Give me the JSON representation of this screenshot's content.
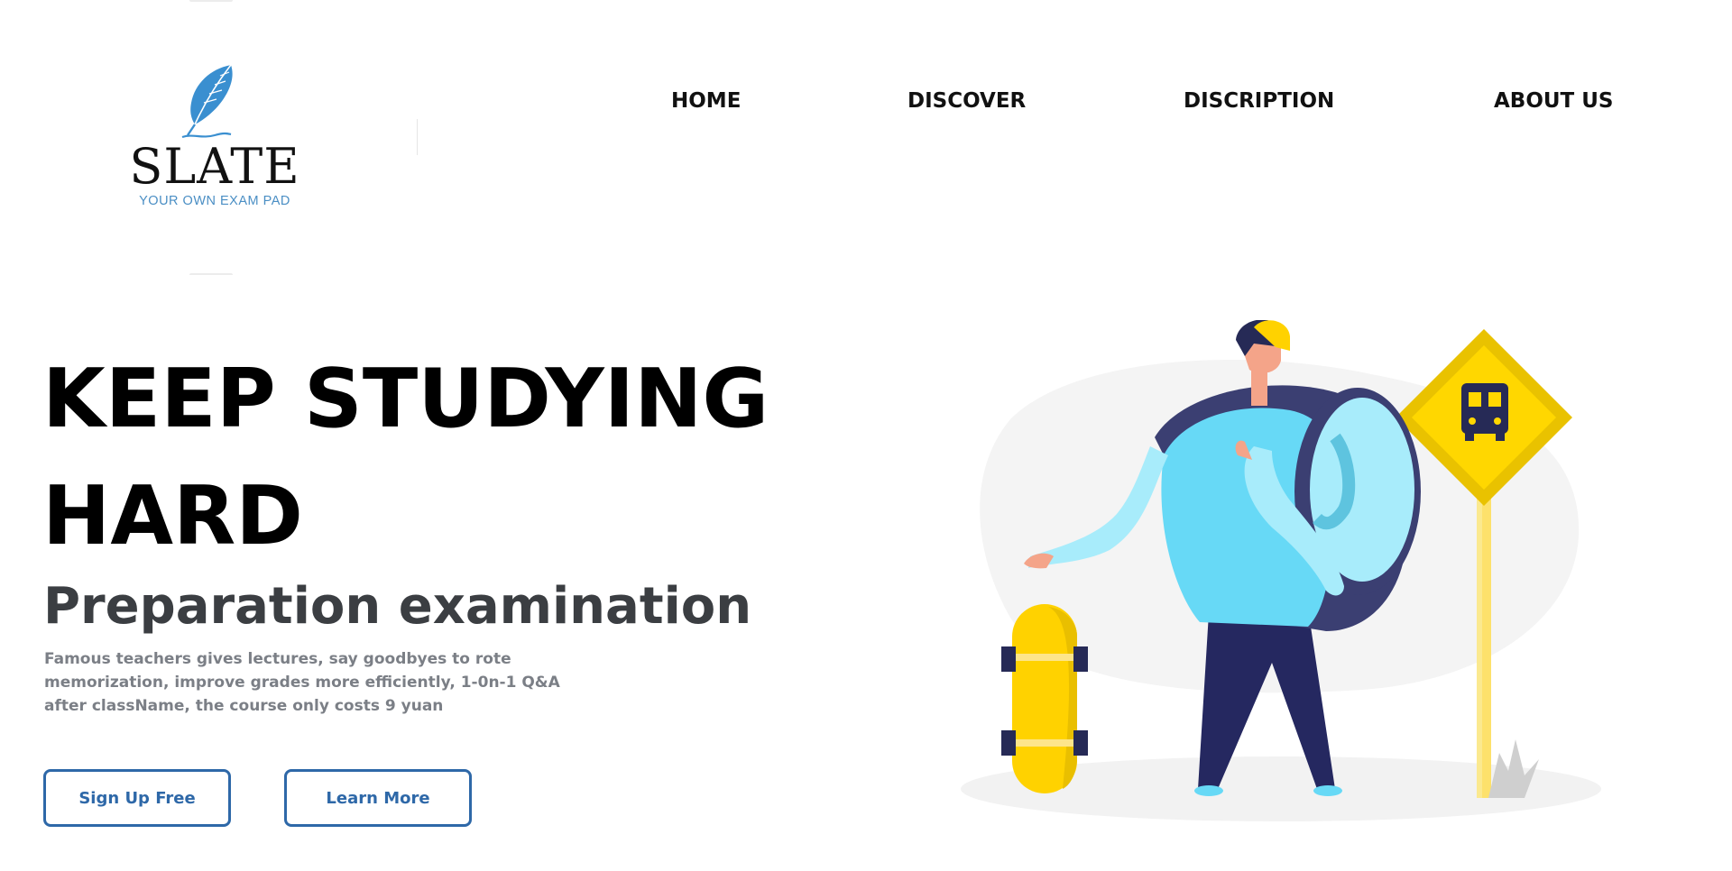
{
  "brand": {
    "name": "SLATE",
    "tagline": "YOUR OWN EXAM PAD"
  },
  "nav": {
    "items": [
      {
        "label": "HOME"
      },
      {
        "label": "DISCOVER"
      },
      {
        "label": "DISCRIPTION"
      },
      {
        "label": "ABOUT US"
      }
    ]
  },
  "hero": {
    "title_line1": "KEEP STUDYING",
    "title_line2": "HARD",
    "subtitle": "Preparation examination",
    "description": "Famous teachers gives lectures, say goodbyes to rote memorization, improve grades more efficiently, 1-0n-1 Q&A after className, the course only costs 9 yuan",
    "buttons": {
      "signup_label": "Sign Up Free",
      "learn_label": "Learn More"
    }
  },
  "colors": {
    "accent": "#2e68a8",
    "text": "#000000",
    "subtitle": "#3b3e42",
    "description": "#7b7f86",
    "logo_blue": "#4a8ec4"
  },
  "icons": {
    "logo": "feather-icon",
    "sign": "bus-stop-sign-icon"
  }
}
